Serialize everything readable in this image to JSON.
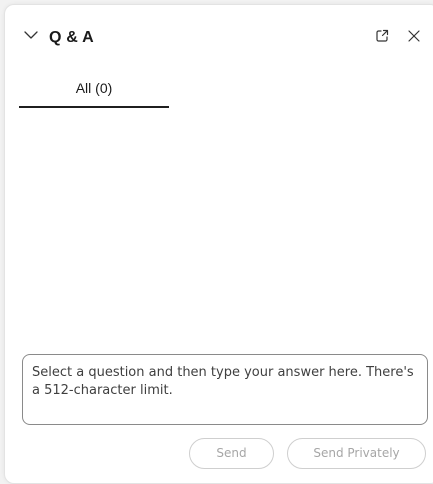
{
  "header": {
    "title": "Q & A",
    "collapse_icon": "chevron-down-icon",
    "popout_icon": "pop-out-icon",
    "close_icon": "close-icon"
  },
  "tabs": [
    {
      "label": "All (0)",
      "selected": true
    }
  ],
  "answer": {
    "value": "",
    "placeholder": "Select a question and then type your answer here. There's a 512-character limit."
  },
  "actions": {
    "send_label": "Send",
    "send_privately_label": "Send Privately",
    "enabled": false
  },
  "colors": {
    "text": "#1a1a1a",
    "disabled_text": "#a6a6a6",
    "border": "#8a8a8a"
  }
}
